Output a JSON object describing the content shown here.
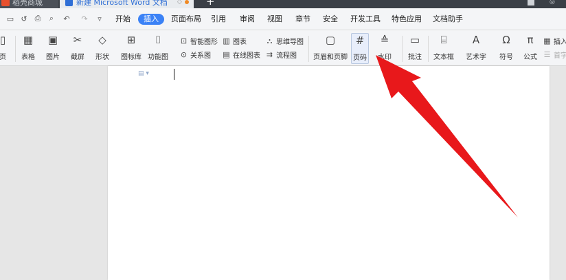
{
  "titlebar": {
    "store_tab": "稻壳商城",
    "doc_tab": "新建 Microsoft Word 文档",
    "new_tab": "+"
  },
  "quick_access": [
    "save-icon",
    "undo-icon",
    "print-icon",
    "preview-icon",
    "undo2-icon",
    "redo-icon",
    "dropdown-icon"
  ],
  "menu": [
    "开始",
    "插入",
    "页面布局",
    "引用",
    "审阅",
    "视图",
    "章节",
    "安全",
    "开发工具",
    "特色应用",
    "文档助手"
  ],
  "active_menu": "插入",
  "ribbon": {
    "page": "页",
    "table": "表格",
    "picture": "图片",
    "screenshot": "截屏",
    "shape": "形状",
    "icon_lib": "图标库",
    "func_chart": "功能图",
    "smart_shape": "智能图形",
    "chart": "图表",
    "mindmap": "思维导图",
    "relation": "关系图",
    "online_chart": "在线图表",
    "flowchart": "流程图",
    "header_footer": "页眉和页脚",
    "page_number": "页码",
    "watermark": "水印",
    "comment": "批注",
    "textbox": "文本框",
    "wordart": "艺术字",
    "symbol": "符号",
    "formula": "公式",
    "insert_more": "插入",
    "dropcap": "首字"
  },
  "colors": {
    "accent": "#3b82f6",
    "arrow": "#e8181b",
    "titlebar": "#3a3f46"
  }
}
